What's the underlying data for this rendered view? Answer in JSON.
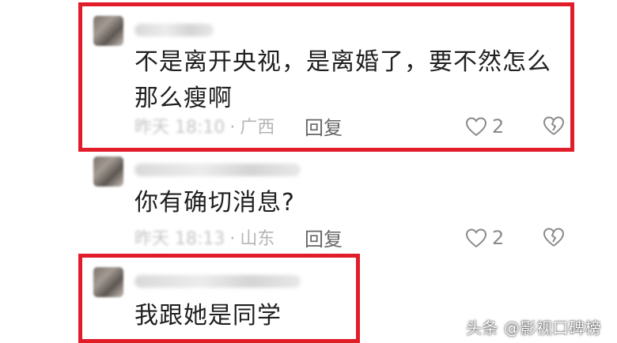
{
  "comments": [
    {
      "text": "不是离开央视，是离婚了，要不然怎么那么瘦啊",
      "time": "昨天 18:10",
      "location": "广西",
      "reply_label": "回复",
      "likes": "2"
    },
    {
      "text": "你有确切消息?",
      "time": "昨天 18:13",
      "location": "山东",
      "reply_label": "回复",
      "likes": "2"
    },
    {
      "text": "我跟她是同学"
    }
  ],
  "watermark": "头条 @影视口碑榜",
  "colors": {
    "highlight_box": "#e11d2a",
    "meta_text": "#b5b5b5"
  }
}
